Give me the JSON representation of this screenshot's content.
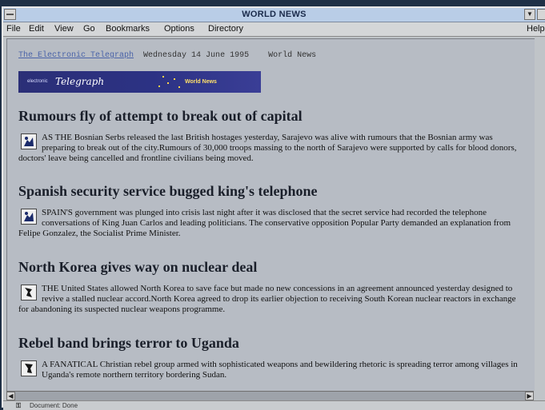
{
  "window": {
    "title": "WORLD NEWS"
  },
  "menu": {
    "file": "File",
    "edit": "Edit",
    "view": "View",
    "go": "Go",
    "bookmarks": "Bookmarks",
    "options": "Options",
    "directory": "Directory",
    "help": "Help"
  },
  "page": {
    "site_link": "The Electronic Telegraph",
    "date": "Wednesday 14 June 1995",
    "section": "World News",
    "banner": {
      "small": "electronic",
      "big": "Telegraph",
      "tag": "World News"
    }
  },
  "stories": [
    {
      "headline": "Rumours fly of attempt to break out of capital",
      "text": "AS THE Bosnian Serbs released the last British hostages yesterday, Sarajevo was alive with rumours that the Bosnian army was preparing to break out of the city.Rumours of 30,000 troops massing to the north of Sarajevo were supported by calls for blood donors, doctors' leave being cancelled and frontline civilians being moved."
    },
    {
      "headline": "Spanish security service bugged king's telephone",
      "text": "SPAIN'S government was plunged into crisis last night after it was disclosed that the secret service had recorded the telephone conversations of King Juan Carlos and leading politicians. The conservative opposition Popular Party demanded an explanation from Felipe Gonzalez, the Socialist Prime Minister."
    },
    {
      "headline": "North Korea gives way on nuclear deal",
      "text": "THE United States allowed North Korea to save face but made no new concessions in an agreement announced yesterday designed to revive a stalled nuclear accord.North Korea agreed to drop its earlier objection to receiving South Korean nuclear reactors in exchange for abandoning its suspected nuclear weapons programme."
    },
    {
      "headline": "Rebel band brings terror to Uganda",
      "text": "A FANATICAL Christian rebel group armed with sophisticated weapons and bewildering rhetoric is spreading terror among villages in Uganda's remote northern territory bordering Sudan."
    }
  ],
  "status": {
    "text": "Document: Done"
  }
}
